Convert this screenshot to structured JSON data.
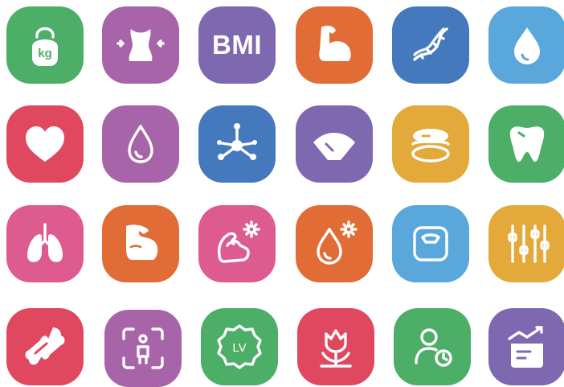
{
  "colors": {
    "green": "#4cae67",
    "purple": "#a864a8",
    "violet": "#7e68b0",
    "orange": "#e26c35",
    "blue": "#4479bd",
    "sky": "#5aa7dc",
    "red": "#e04860",
    "yellow": "#e3a93a",
    "pink": "#dd5b8e"
  },
  "tiles": [
    {
      "icon": "kettlebell-icon",
      "text": "kg"
    },
    {
      "icon": "waist-measure-icon"
    },
    {
      "icon": "bmi-icon",
      "text": "BMI"
    },
    {
      "icon": "flexed-arm-icon"
    },
    {
      "icon": "dna-icon"
    },
    {
      "icon": "water-drop-icon"
    },
    {
      "icon": "heart-icon"
    },
    {
      "icon": "blood-drop-icon"
    },
    {
      "icon": "molecule-icon"
    },
    {
      "icon": "gauge-icon"
    },
    {
      "icon": "macaron-icon"
    },
    {
      "icon": "tooth-icon"
    },
    {
      "icon": "lungs-icon"
    },
    {
      "icon": "bicep-icon"
    },
    {
      "icon": "muscle-flower-icon"
    },
    {
      "icon": "drop-flower-icon"
    },
    {
      "icon": "bathroom-scale-icon"
    },
    {
      "icon": "sliders-icon"
    },
    {
      "icon": "bone-icon"
    },
    {
      "icon": "body-scan-icon"
    },
    {
      "icon": "level-badge-icon",
      "text": "LV"
    },
    {
      "icon": "tulip-icon"
    },
    {
      "icon": "user-clock-icon"
    },
    {
      "icon": "chart-doc-icon"
    }
  ]
}
